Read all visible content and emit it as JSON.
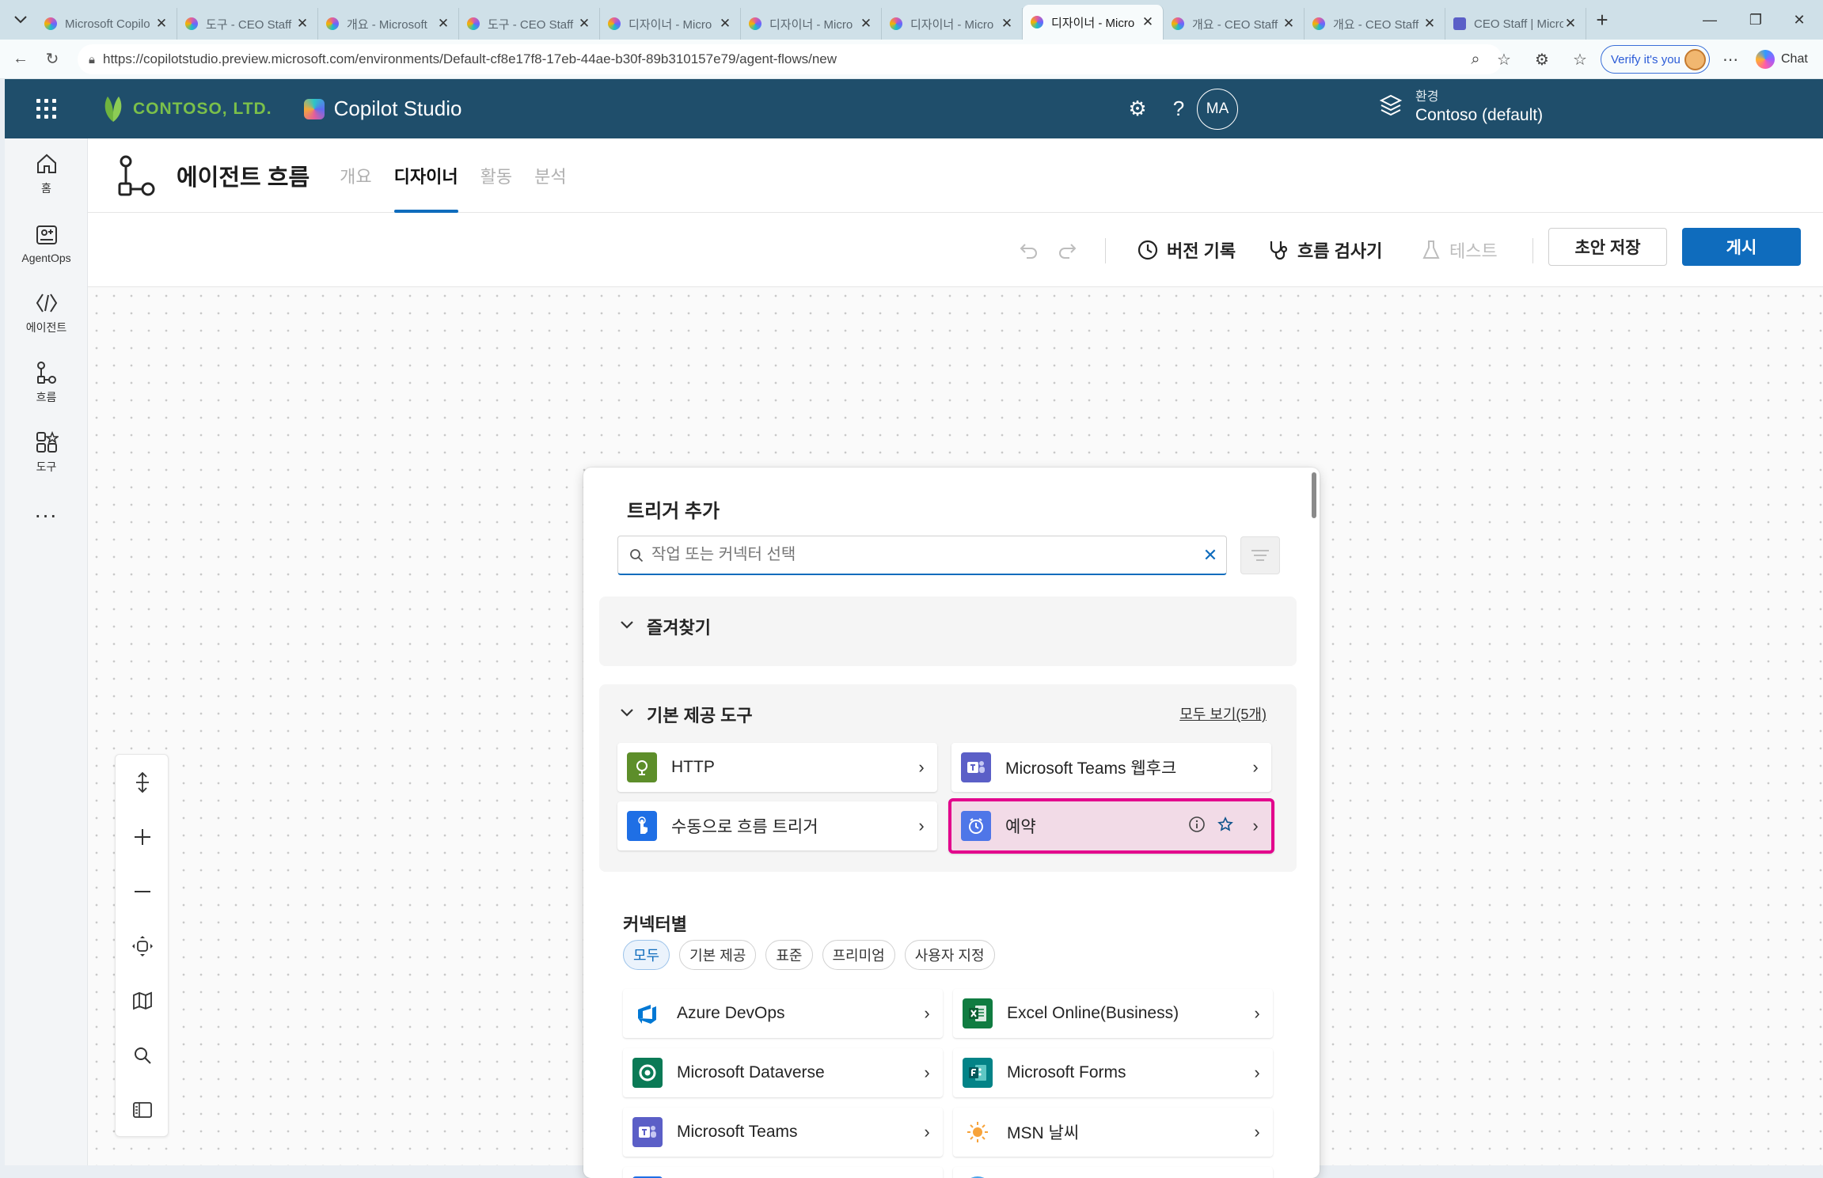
{
  "browser": {
    "tabs": [
      {
        "label": "Microsoft Copilo",
        "icon": "copilot-studio-icon"
      },
      {
        "label": "도구 - CEO Staff",
        "icon": "copilot-studio-icon"
      },
      {
        "label": "개요 - Microsoft",
        "icon": "copilot-studio-icon"
      },
      {
        "label": "도구 - CEO Staff",
        "icon": "copilot-studio-icon"
      },
      {
        "label": "디자이너 - Micro",
        "icon": "copilot-studio-icon"
      },
      {
        "label": "디자이너 - Micro",
        "icon": "copilot-studio-icon"
      },
      {
        "label": "디자이너 - Micro",
        "icon": "copilot-studio-icon"
      },
      {
        "label": "디자이너 - Micro",
        "icon": "copilot-studio-icon",
        "active": true
      },
      {
        "label": "개요 - CEO Staff",
        "icon": "copilot-studio-icon"
      },
      {
        "label": "개요 - CEO Staff",
        "icon": "copilot-studio-icon"
      },
      {
        "label": "CEO Staff | Micro",
        "icon": "teams-icon"
      }
    ],
    "url": "https://copilotstudio.preview.microsoft.com/environments/Default-cf8e17f8-17eb-44ae-b30f-89b310157e79/agent-flows/new",
    "verify_label": "Verify it's you",
    "chat_label": "Chat"
  },
  "header": {
    "company": "CONTOSO, LTD.",
    "product": "Copilot Studio",
    "env_label": "환경",
    "env_value": "Contoso (default)",
    "avatar_initials": "MA"
  },
  "rail": {
    "items": [
      {
        "label": "홈",
        "icon": "home-icon"
      },
      {
        "label": "AgentOps",
        "icon": "agentops-icon"
      },
      {
        "label": "에이전트",
        "icon": "agent-icon"
      },
      {
        "label": "흐름",
        "icon": "flow-icon"
      },
      {
        "label": "도구",
        "icon": "tools-icon"
      }
    ],
    "more": "..."
  },
  "page": {
    "title": "에이전트 흐름",
    "tabs": [
      {
        "label": "개요"
      },
      {
        "label": "디자이너",
        "active": true
      },
      {
        "label": "활동"
      },
      {
        "label": "분석"
      }
    ]
  },
  "toolbar": {
    "version_history": "버전 기록",
    "flow_checker": "흐름 검사기",
    "test": "테스트",
    "save_draft": "초안 저장",
    "publish": "게시"
  },
  "trigger_panel": {
    "title": "트리거 추가",
    "search_placeholder": "작업 또는 커넥터 선택",
    "favorites": {
      "title": "즐겨찾기"
    },
    "builtin": {
      "title": "기본 제공 도구",
      "see_all": "모두 보기(5개)",
      "items": [
        {
          "label": "HTTP",
          "icon": "http-icon",
          "color": "#5d8e2a"
        },
        {
          "label": "Microsoft Teams 웹후크",
          "icon": "teams-icon",
          "color": "#5b5fc7"
        },
        {
          "label": "수동으로 흐름 트리거",
          "icon": "manual-trigger-icon",
          "color": "#1f6fe5"
        },
        {
          "label": "예약",
          "icon": "schedule-icon",
          "color": "#4f76e8",
          "selected": true
        }
      ]
    },
    "connectors": {
      "title": "커넥터별",
      "filters": [
        {
          "label": "모두",
          "active": true
        },
        {
          "label": "기본 제공"
        },
        {
          "label": "표준"
        },
        {
          "label": "프리미엄"
        },
        {
          "label": "사용자 지정"
        }
      ],
      "items": [
        {
          "label": "Azure DevOps",
          "icon": "azure-devops-icon",
          "color": "#0078d4"
        },
        {
          "label": "Excel Online(Business)",
          "icon": "excel-icon",
          "color": "#107c41"
        },
        {
          "label": "Microsoft Dataverse",
          "icon": "dataverse-icon",
          "color": "#0b7a56"
        },
        {
          "label": "Microsoft Forms",
          "icon": "forms-icon",
          "color": "#038387"
        },
        {
          "label": "Microsoft Teams",
          "icon": "teams-icon",
          "color": "#5b5fc7"
        },
        {
          "label": "MSN 날씨",
          "icon": "weather-icon",
          "color": "#f7a33b"
        }
      ]
    }
  }
}
